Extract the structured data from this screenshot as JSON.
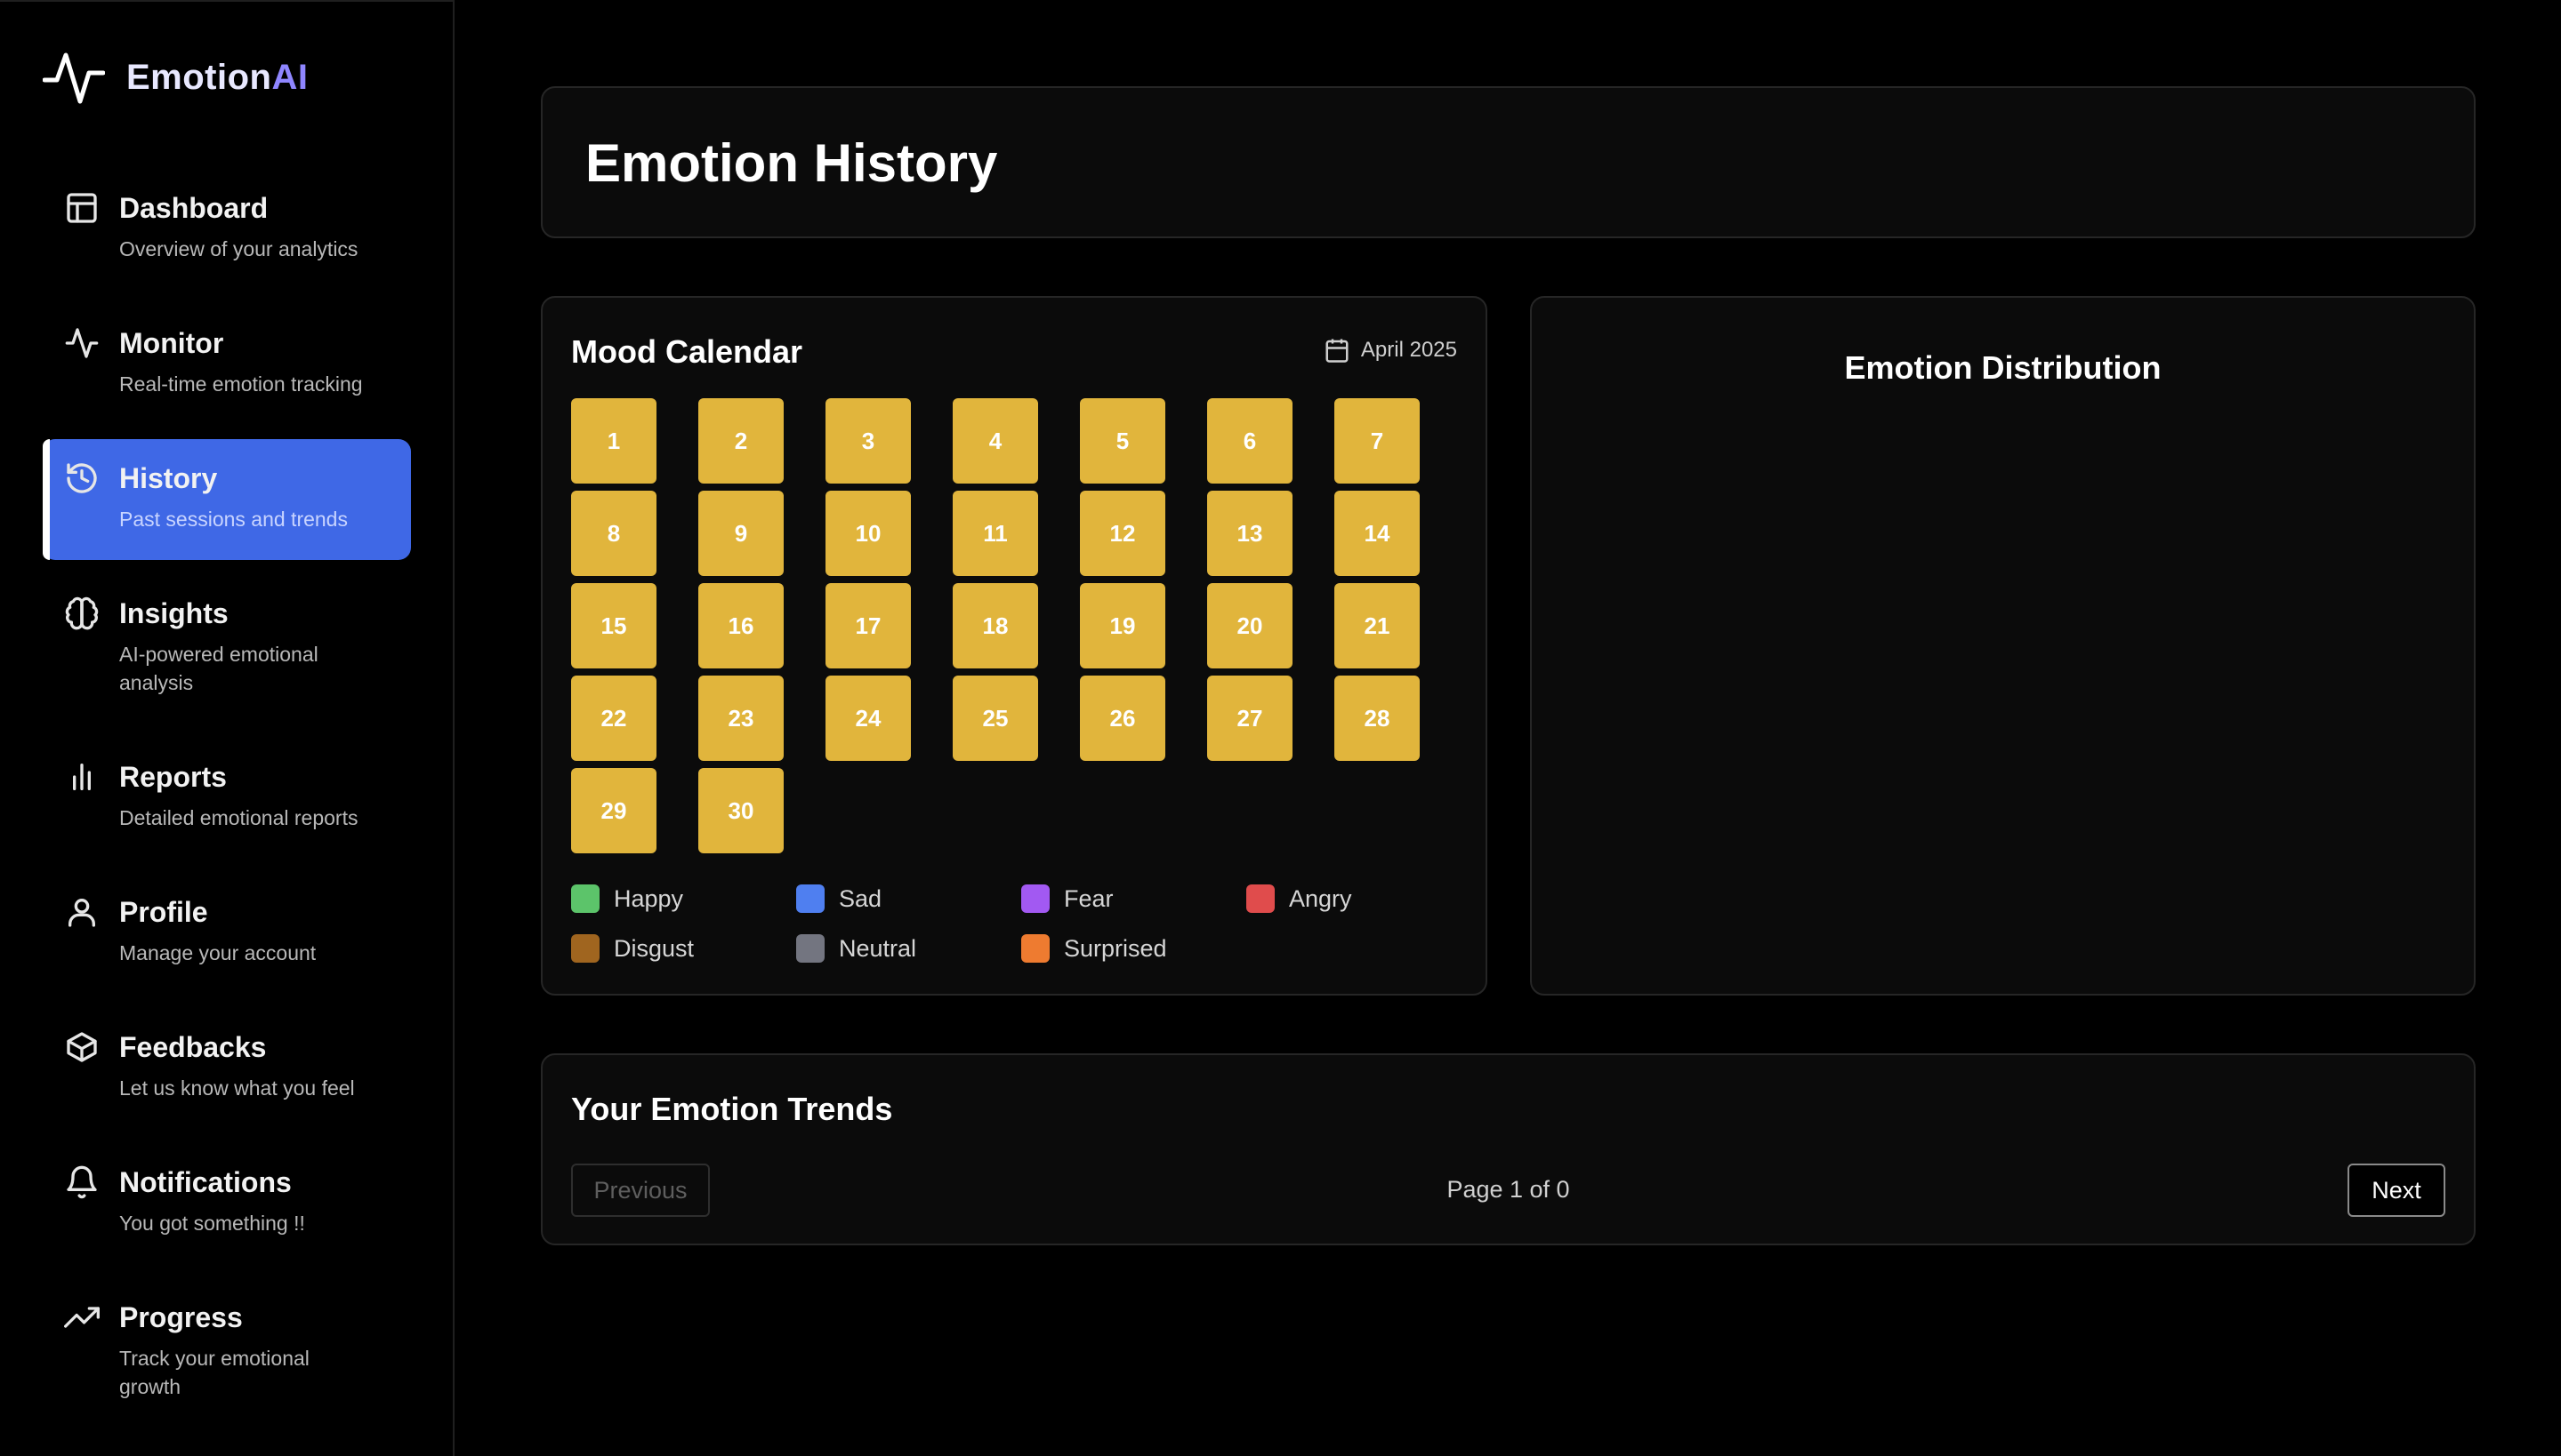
{
  "brand": {
    "part1": "Emotion",
    "part2": "AI"
  },
  "sidebar": {
    "items": [
      {
        "label": "Dashboard",
        "desc": "Overview of your analytics",
        "icon": "layout-icon"
      },
      {
        "label": "Monitor",
        "desc": "Real-time emotion tracking",
        "icon": "activity-icon"
      },
      {
        "label": "History",
        "desc": "Past sessions and trends",
        "icon": "history-icon",
        "active": true
      },
      {
        "label": "Insights",
        "desc": "AI-powered emotional analysis",
        "icon": "brain-icon"
      },
      {
        "label": "Reports",
        "desc": "Detailed emotional reports",
        "icon": "bar-chart-icon"
      },
      {
        "label": "Profile",
        "desc": "Manage your account",
        "icon": "user-icon"
      },
      {
        "label": "Feedbacks",
        "desc": "Let us know what you feel",
        "icon": "package-icon"
      },
      {
        "label": "Notifications",
        "desc": "You got something !!",
        "icon": "bell-icon"
      },
      {
        "label": "Progress",
        "desc": "Track your emotional growth",
        "icon": "trending-up-icon"
      }
    ]
  },
  "header": {
    "title": "Emotion History"
  },
  "calendar": {
    "title": "Mood Calendar",
    "month": "April 2025",
    "day_color": "#e1b53c",
    "days": [
      "1",
      "2",
      "3",
      "4",
      "5",
      "6",
      "7",
      "8",
      "9",
      "10",
      "11",
      "12",
      "13",
      "14",
      "15",
      "16",
      "17",
      "18",
      "19",
      "20",
      "21",
      "22",
      "23",
      "24",
      "25",
      "26",
      "27",
      "28",
      "29",
      "30"
    ],
    "legend": [
      {
        "label": "Happy",
        "color": "#5cc46a"
      },
      {
        "label": "Sad",
        "color": "#4f7ff0"
      },
      {
        "label": "Fear",
        "color": "#a259f2"
      },
      {
        "label": "Angry",
        "color": "#e04c4c"
      },
      {
        "label": "Disgust",
        "color": "#a0651f"
      },
      {
        "label": "Neutral",
        "color": "#737580"
      },
      {
        "label": "Surprised",
        "color": "#ee7b30"
      }
    ]
  },
  "distribution": {
    "title": "Emotion Distribution"
  },
  "trends": {
    "title": "Your Emotion Trends",
    "prev_label": "Previous",
    "next_label": "Next",
    "page_info": "Page 1 of 0"
  }
}
